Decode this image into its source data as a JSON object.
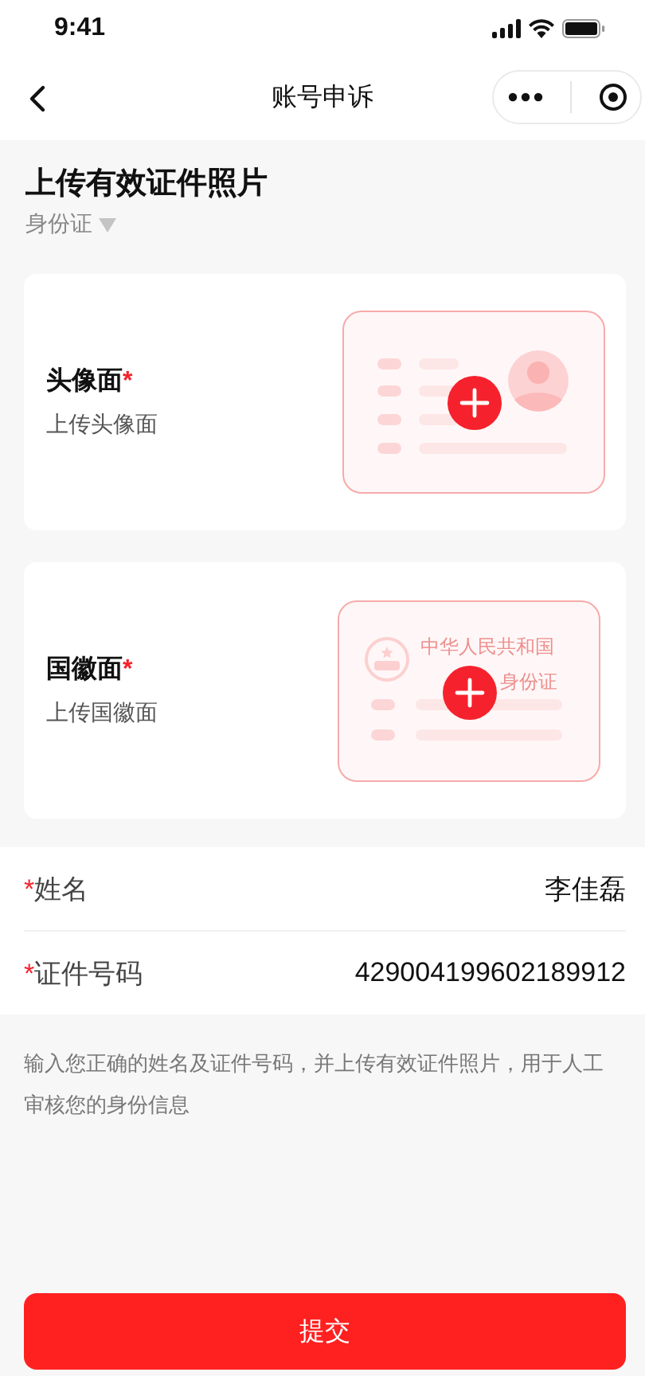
{
  "status_bar": {
    "time": "9:41"
  },
  "nav": {
    "title": "账号申诉"
  },
  "section": {
    "title": "上传有效证件照片",
    "doc_type": "身份证"
  },
  "uploads": [
    {
      "kind": "portrait",
      "label": "头像面",
      "required_mark": "*",
      "hint": "上传头像面"
    },
    {
      "kind": "emblem",
      "label": "国徽面",
      "required_mark": "*",
      "hint": "上传国徽面",
      "card_text": [
        "中华人民共和国",
        "身份证"
      ]
    }
  ],
  "fields": [
    {
      "mark": "*",
      "label": "姓名",
      "value": "李佳磊"
    },
    {
      "mark": "*",
      "label": "证件号码",
      "value": "429004199602189912"
    }
  ],
  "note": "输入您正确的姓名及证件号码，并上传有效证件照片，用于人工审核您的身份信息",
  "submit": "提交"
}
